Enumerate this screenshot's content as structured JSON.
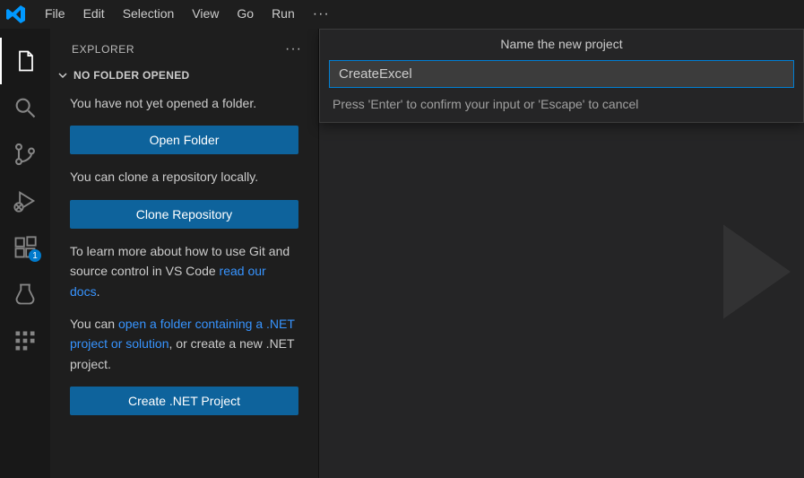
{
  "menubar": {
    "items": [
      "File",
      "Edit",
      "Selection",
      "View",
      "Go",
      "Run"
    ],
    "more": "···"
  },
  "activity": {
    "badge": "1"
  },
  "sidebar": {
    "title": "EXPLORER",
    "more": "···",
    "section_label": "NO FOLDER OPENED",
    "text_no_folder": "You have not yet opened a folder.",
    "open_folder_btn": "Open Folder",
    "text_clone": "You can clone a repository locally.",
    "clone_btn": "Clone Repository",
    "text_learn_pre": "To learn more about how to use Git and source control in VS Code ",
    "link_docs": "read our docs",
    "period1": ".",
    "text_open_pre": "You can ",
    "link_open": "open a folder containing a .NET project or solution",
    "text_open_post": ", or create a new .NET project.",
    "create_btn": "Create .NET Project"
  },
  "quickInput": {
    "title": "Name the new project",
    "value": "CreateExcel",
    "hint": "Press 'Enter' to confirm your input or 'Escape' to cancel"
  }
}
